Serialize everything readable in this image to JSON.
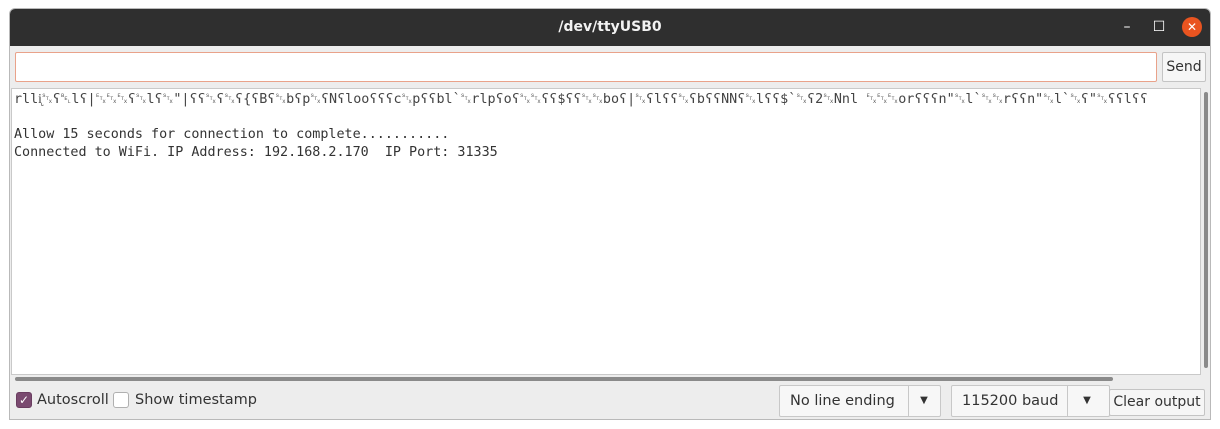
{
  "window": {
    "title": "/dev/ttyUSB0",
    "minimize_glyph": "–",
    "maximize_glyph": "☐",
    "close_glyph": "✕"
  },
  "send_bar": {
    "input_value": "",
    "send_label": "Send"
  },
  "output": {
    "lines": [
      "rllᶖ␂ʕ␇lʕ|␃␃␃ʕ␂lʕ␂\"|ʕʕ␂ʕ␂ʕ{ʕBʕ␂bʕp␂ʕNʕlooʕʕʕc␂pʕʕbl`␂rlpʕoʕ␂␂ʕʕ$ʕʕ␂␂boʕ|␂ʕlʕʕ␂ʕbʕʕNNʕ␂lʕʕ$`␂ʕ2␂Nnl ␃␃␃orʕʕʕn\"␂l`␂␂rʕʕn\"␂l`␂ʕ\"␂ʕʕlʕʕ",
      "Allow 15 seconds for connection to complete...........",
      "Connected to WiFi. IP Address: 192.168.2.170  IP Port: 31335"
    ]
  },
  "bottom_bar": {
    "autoscroll_label": "Autoscroll",
    "autoscroll_checked": true,
    "timestamp_label": "Show timestamp",
    "timestamp_checked": false,
    "line_ending_value": "No line ending",
    "baud_value": "115200 baud",
    "clear_label": "Clear output"
  },
  "colors": {
    "titlebar": "#2f2f2f",
    "close_button": "#e95420",
    "checkbox_checked": "#7a4a70",
    "input_border": "#e9a28a"
  },
  "icons": {
    "dropdown": "chevron-down-icon",
    "check": "check-icon"
  }
}
